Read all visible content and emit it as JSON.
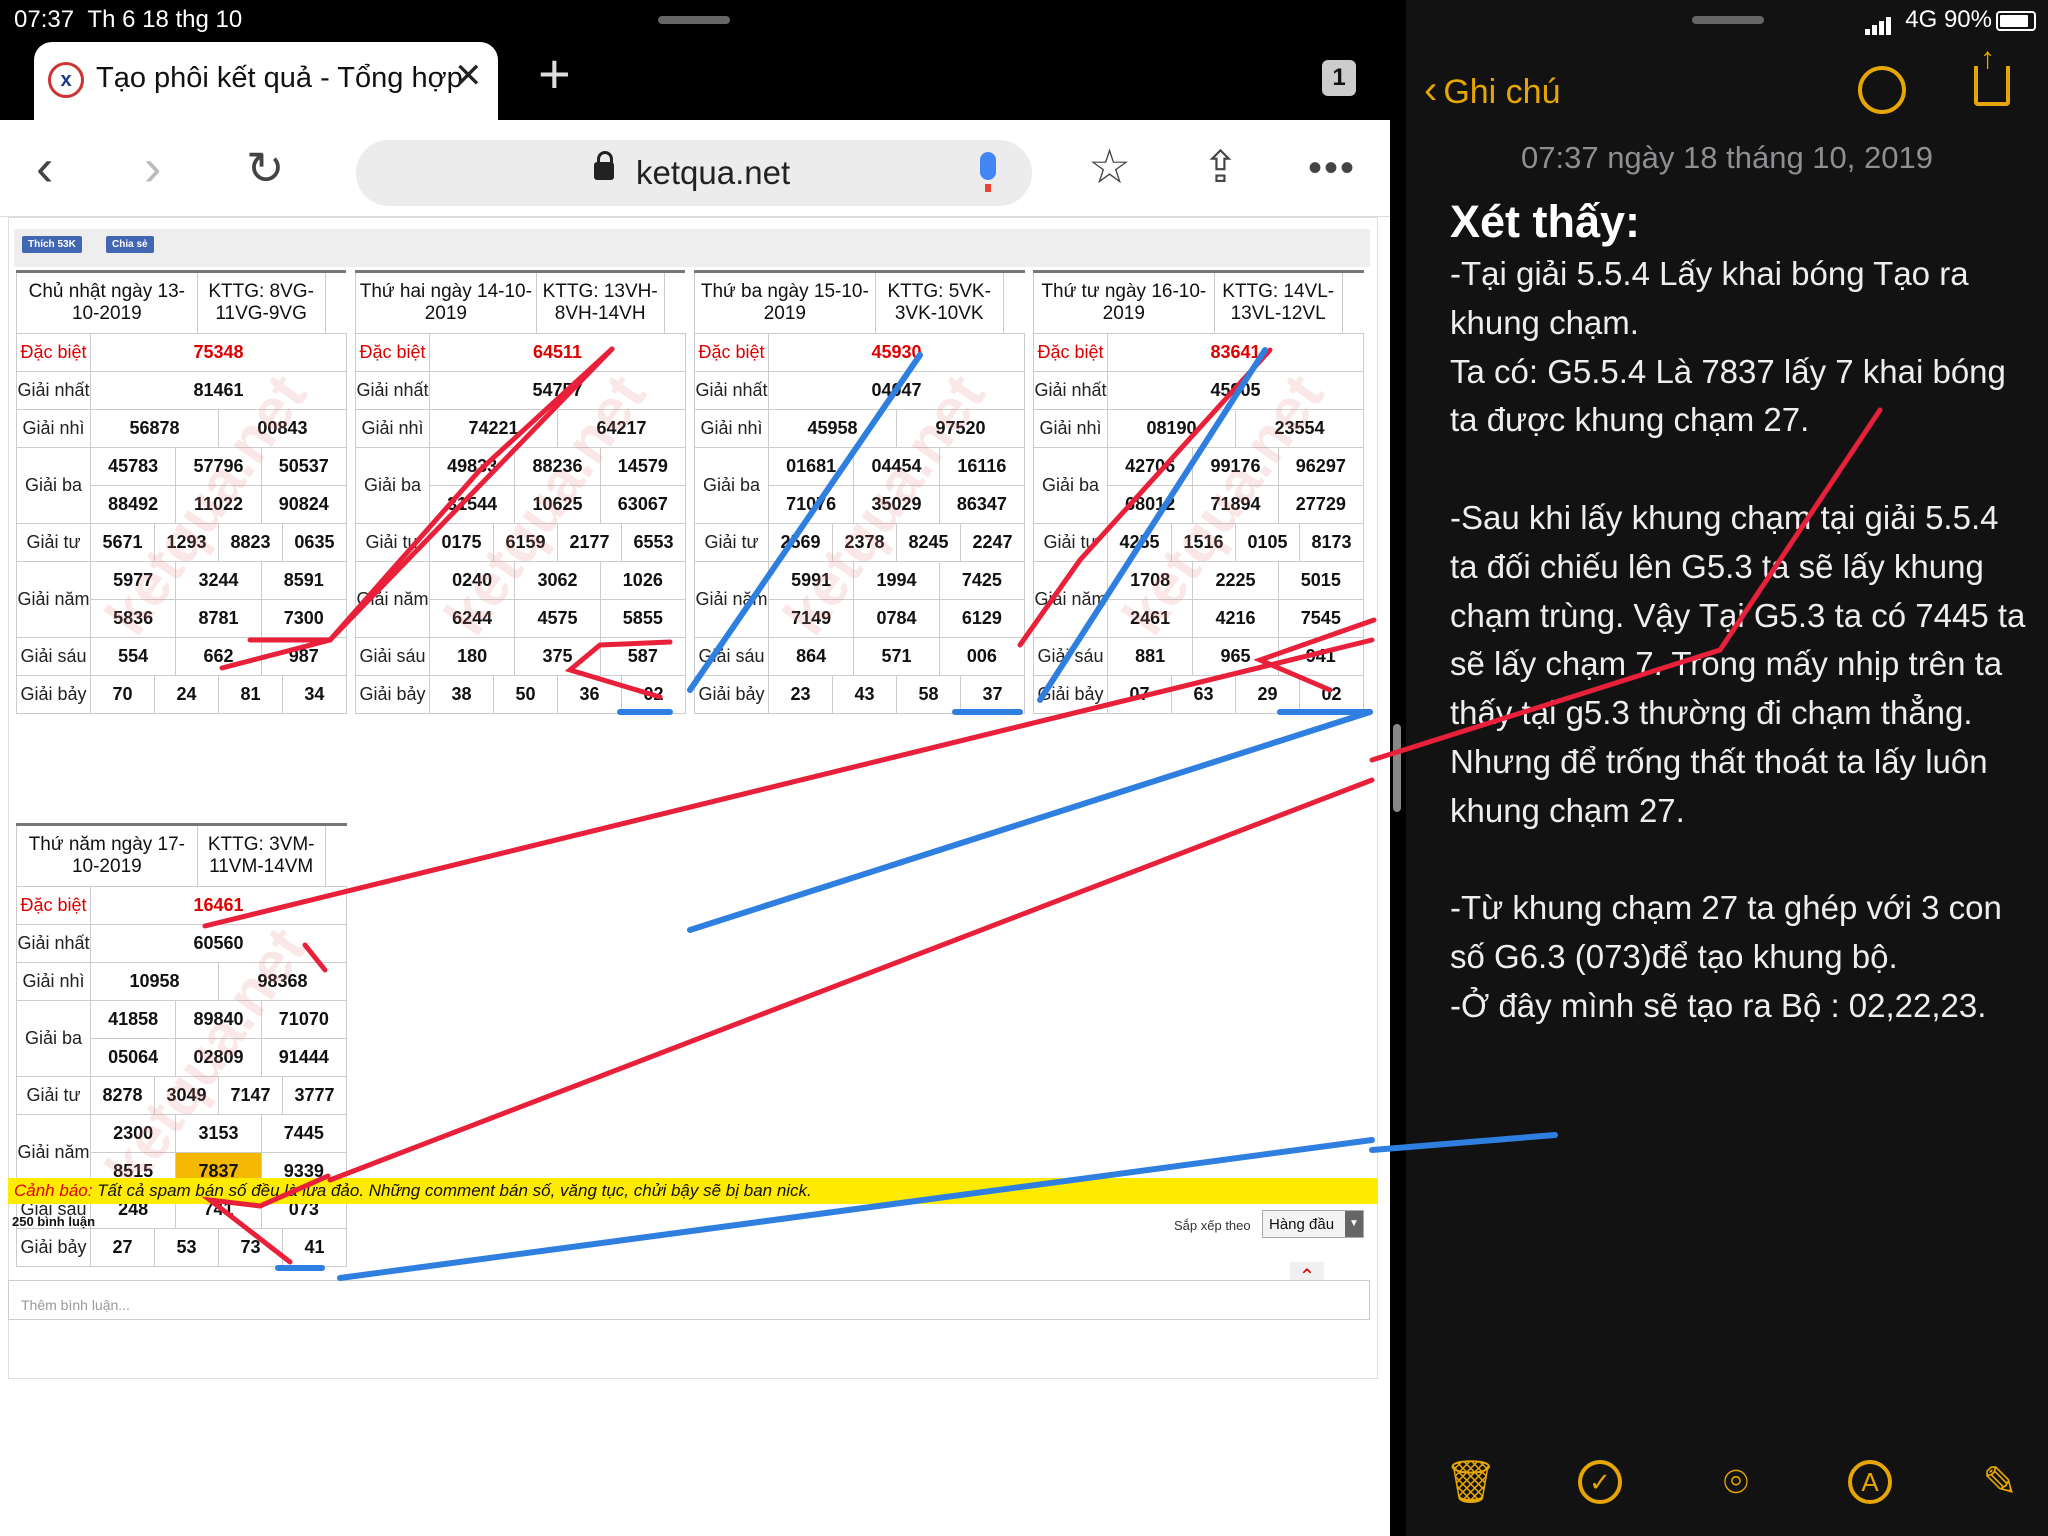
{
  "status": {
    "time": "07:37",
    "date": "Th 6 18 thg 10",
    "network": "4G",
    "battery": "90%"
  },
  "browser": {
    "tab_title": "Tạo phôi kết quả - Tổng hợp",
    "tab_count": "1",
    "url": "ketqua.net",
    "icons": [
      "back-icon",
      "forward-icon",
      "reload-icon",
      "lock-icon",
      "mic-icon",
      "star-icon",
      "share-icon",
      "more-icon",
      "plus-icon",
      "close-icon"
    ]
  },
  "social": {
    "like": "Thích 53K",
    "share": "Chia sẻ"
  },
  "labels": {
    "db": "Đặc biệt",
    "g1": "Giải nhất",
    "g2": "Giải nhì",
    "g3": "Giải ba",
    "g4": "Giải tư",
    "g5": "Giải năm",
    "g6": "Giải sáu",
    "g7": "Giải bảy"
  },
  "results": [
    {
      "date": "Chủ nhật ngày 13-10-2019",
      "kttg": "KTTG: 8VG-11VG-9VG",
      "db": "75348",
      "g1": "81461",
      "g2": [
        "56878",
        "00843"
      ],
      "g3": [
        "45783",
        "57796",
        "50537",
        "88492",
        "11022",
        "90824"
      ],
      "g4": [
        "5671",
        "1293",
        "8823",
        "0635"
      ],
      "g5": [
        "5977",
        "3244",
        "8591",
        "5836",
        "8781",
        "7300"
      ],
      "g6": [
        "554",
        "662",
        "987"
      ],
      "g7": [
        "70",
        "24",
        "81",
        "34"
      ]
    },
    {
      "date": "Thứ hai ngày 14-10-2019",
      "kttg": "KTTG: 13VH-8VH-14VH",
      "db": "64511",
      "g1": "54757",
      "g2": [
        "74221",
        "64217"
      ],
      "g3": [
        "49833",
        "88236",
        "14579",
        "31544",
        "10625",
        "63067"
      ],
      "g4": [
        "0175",
        "6159",
        "2177",
        "6553"
      ],
      "g5": [
        "0240",
        "3062",
        "1026",
        "6244",
        "4575",
        "5855"
      ],
      "g6": [
        "180",
        "375",
        "587"
      ],
      "g7": [
        "38",
        "50",
        "36",
        "02"
      ]
    },
    {
      "date": "Thứ ba ngày 15-10-2019",
      "kttg": "KTTG: 5VK-3VK-10VK",
      "db": "45930",
      "g1": "04047",
      "g2": [
        "45958",
        "97520"
      ],
      "g3": [
        "01681",
        "04454",
        "16116",
        "71076",
        "35029",
        "86347"
      ],
      "g4": [
        "2569",
        "2378",
        "8245",
        "2247"
      ],
      "g5": [
        "5991",
        "1994",
        "7425",
        "7149",
        "0784",
        "6129"
      ],
      "g6": [
        "864",
        "571",
        "006"
      ],
      "g7": [
        "23",
        "43",
        "58",
        "37"
      ]
    },
    {
      "date": "Thứ tư ngày 16-10-2019",
      "kttg": "KTTG: 14VL-13VL-12VL",
      "db": "83641",
      "g1": "45905",
      "g2": [
        "08190",
        "23554"
      ],
      "g3": [
        "42706",
        "99176",
        "96297",
        "68012",
        "71894",
        "27729"
      ],
      "g4": [
        "4255",
        "1516",
        "0105",
        "8173"
      ],
      "g5": [
        "1708",
        "2225",
        "5015",
        "2461",
        "4216",
        "7545"
      ],
      "g6": [
        "881",
        "965",
        "941"
      ],
      "g7": [
        "07",
        "63",
        "29",
        "02"
      ]
    },
    {
      "date": "Thứ năm ngày 17-10-2019",
      "kttg": "KTTG: 3VM-11VM-14VM",
      "db": "16461",
      "g1": "60560",
      "g2": [
        "10958",
        "98368"
      ],
      "g3": [
        "41858",
        "89840",
        "71070",
        "05064",
        "02809",
        "91444"
      ],
      "g4": [
        "8278",
        "3049",
        "7147",
        "3777"
      ],
      "g5": [
        "2300",
        "3153",
        "7445",
        "8515",
        "7837",
        "9339"
      ],
      "g6": [
        "248",
        "741",
        "073"
      ],
      "g7": [
        "27",
        "53",
        "73",
        "41"
      ]
    }
  ],
  "warning": {
    "label": "Cảnh báo:",
    "text": " Tất cả spam bán số đều là lừa đảo. Những comment bán số, văng tục, chửi bậy sẽ bị ban nick."
  },
  "comments": {
    "count": "250 bình luận",
    "sort_label": "Sắp xếp theo",
    "sort_value": "Hàng đầu",
    "placeholder": "Thêm bình luận..."
  },
  "watermark": "ketqua.net",
  "notes": {
    "back": "Ghi chú",
    "date": "07:37 ngày 18 tháng 10, 2019",
    "title": "Xét thấy:",
    "p1": "-Tại giải 5.5.4 Lấy khai bóng Tạo ra khung chạm.",
    "p2": "Ta có: G5.5.4 Là 7837 lấy 7 khai bóng ta được khung chạm 27.",
    "p3": "-Sau khi lấy khung chạm tại giải 5.5.4 ta đối chiếu lên G5.3 ta sẽ lấy khung chạm trùng. Vậy Tại G5.3 ta có 7445 ta sẽ lấy chạm 7. Trong mấy nhịp trên ta thấy tại g5.3 thường đi chạm thẳng. Nhưng để trống thất thoát ta lấy luôn khung chạm 27.",
    "p4": "-Từ khung chạm 27 ta ghép với  3 con số G6.3 (073)để tạo khung bộ.",
    "p5": "-Ở đây mình sẽ tạo ra Bộ : 02,22,23.",
    "toolbar_icons": [
      "trash-icon",
      "checklist-icon",
      "camera-icon",
      "markup-icon",
      "compose-icon"
    ]
  },
  "colors": {
    "accent": "#e6a600",
    "red": "#dd0000",
    "highlight": "#f5b800",
    "annotation_red": "#e8203a",
    "annotation_blue": "#2f7fe0"
  }
}
